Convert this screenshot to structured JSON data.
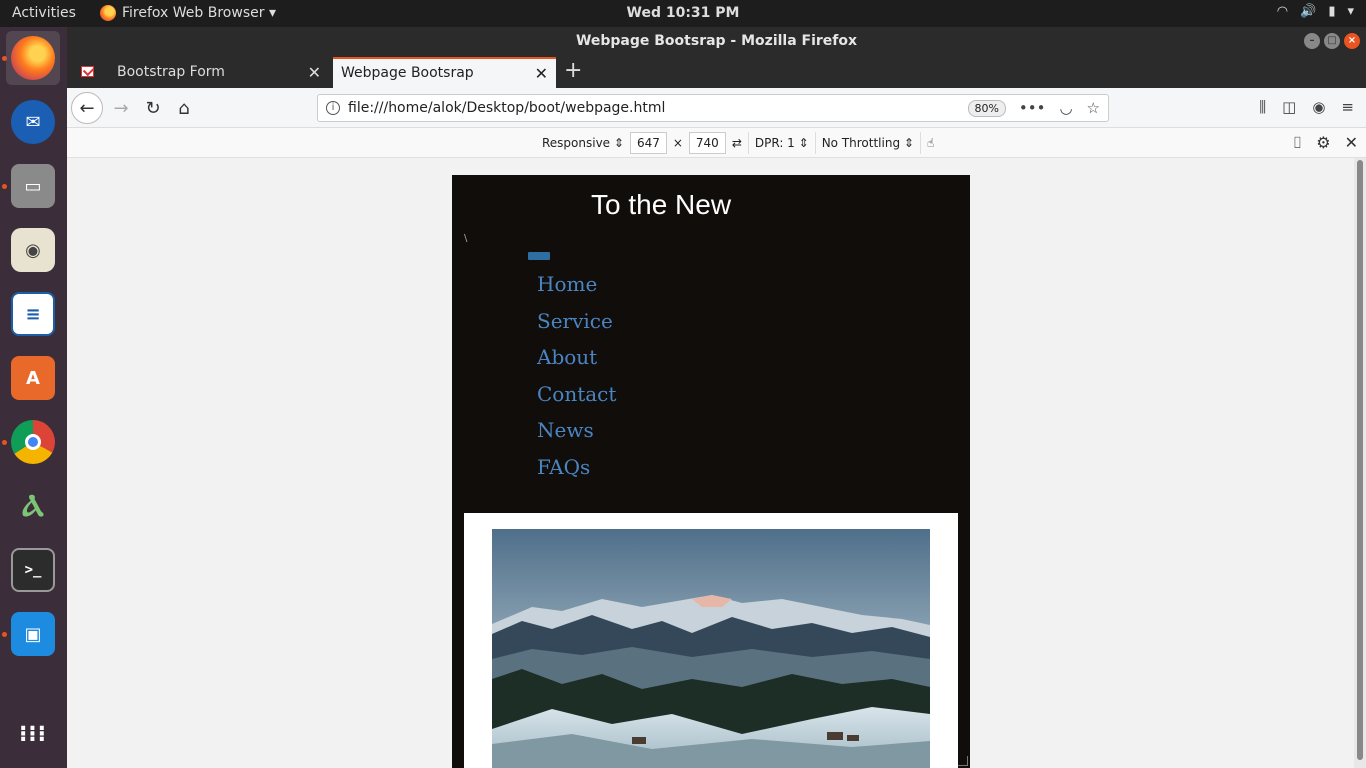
{
  "topbar": {
    "activities": "Activities",
    "app_menu": "Firefox Web Browser ▾",
    "clock": "Wed 10:31 PM"
  },
  "window": {
    "title": "Webpage Bootsrap - Mozilla Firefox"
  },
  "tabs": [
    {
      "label": "Bootstrap Form",
      "active": false
    },
    {
      "label": "Webpage Bootsrap",
      "active": true
    }
  ],
  "urlbar": {
    "url": "file:///home/alok/Desktop/boot/webpage.html",
    "zoom": "80%"
  },
  "responsive_toolbar": {
    "device": "Responsive ⇕",
    "width": "647",
    "times": "×",
    "height": "740",
    "dpr": "DPR: 1 ⇕",
    "throttling": "No Throttling ⇕"
  },
  "webpage": {
    "brand": "To the New",
    "menu": [
      "Home",
      "Service",
      "About",
      "Contact",
      "News",
      "FAQs"
    ],
    "toggler_color": "#2f6ea3",
    "link_color": "#4a85c2",
    "background": "#100d0b"
  },
  "dock": {
    "items": [
      "firefox-icon",
      "thunderbird-icon",
      "files-icon",
      "rhythmbox-icon",
      "writer-icon",
      "software-icon",
      "chrome-icon",
      "android-studio-icon",
      "terminal-icon",
      "app-icon",
      "show-apps-icon"
    ]
  }
}
